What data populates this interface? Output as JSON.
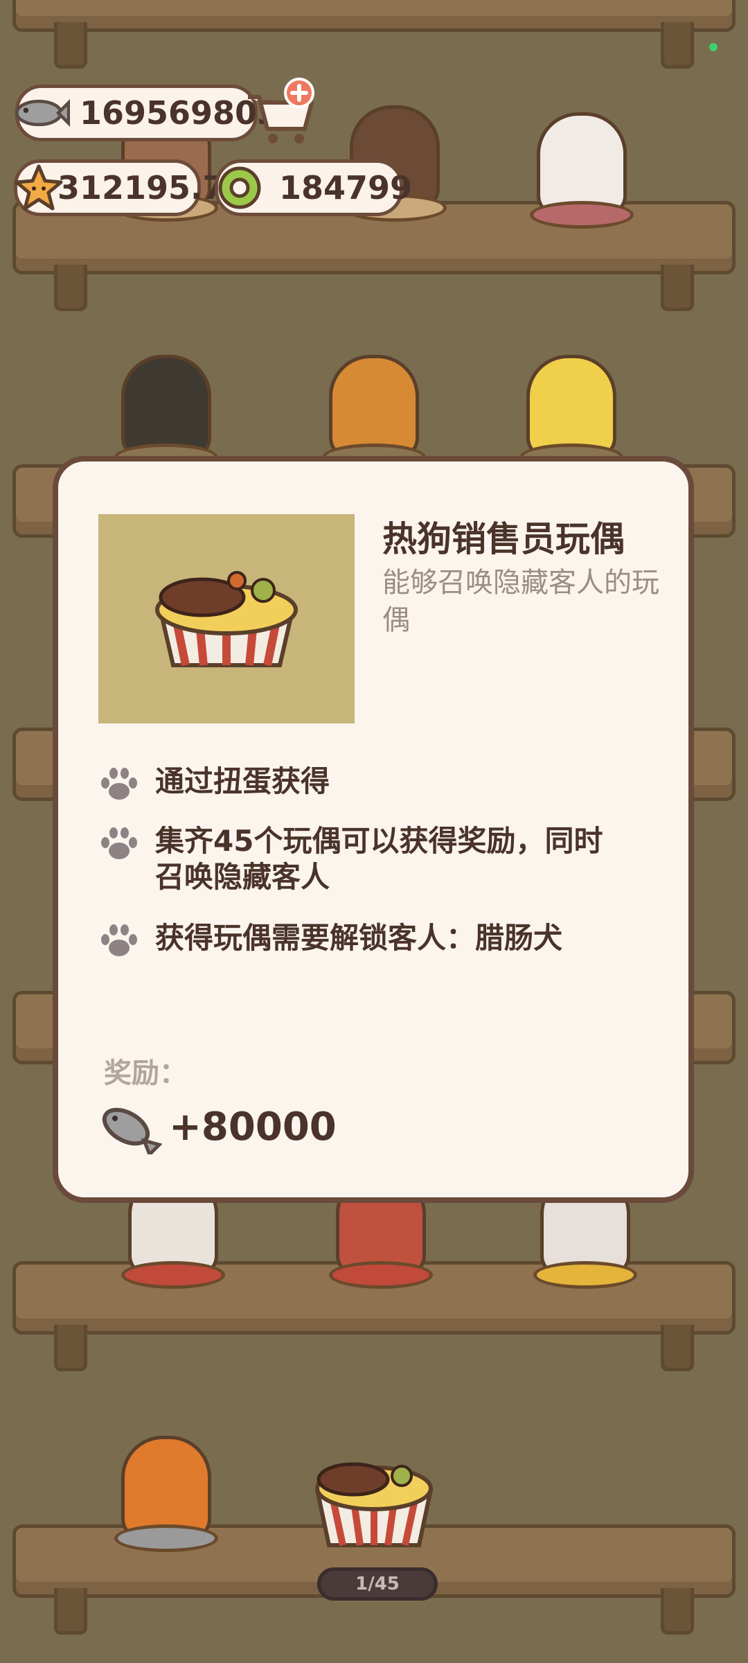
{
  "currencies": {
    "fish": "169569803",
    "star": "312195.7",
    "ring": "184799"
  },
  "popup": {
    "title": "热狗销售员玩偶",
    "description": "能够召唤隐藏客人的玩偶",
    "info": [
      "通过扭蛋获得",
      "集齐45个玩偶可以获得奖励，同时召唤隐藏客人",
      "获得玩偶需要解锁客人：腊肠犬"
    ],
    "reward_label": "奖励：",
    "reward_value": "+80000"
  },
  "pager": "1/45",
  "icons": {
    "fish": "fish-icon",
    "cart": "cart-plus-icon",
    "star": "star-icon",
    "ring": "green-ring-icon",
    "paw": "paw-icon"
  },
  "colors": {
    "background": "#7a6c4e",
    "shelf": "#8f7350",
    "modal_bg": "#fbf5ee",
    "item_bg": "#c7b579",
    "text_dark": "#4a332a",
    "text_muted": "#9b8d86"
  }
}
